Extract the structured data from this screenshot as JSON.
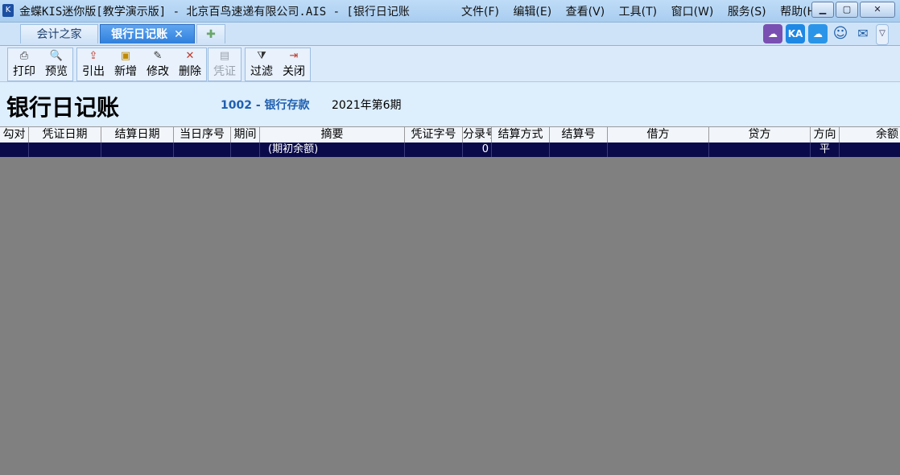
{
  "window": {
    "title": "金蝶KIS迷你版[教学演示版] - 北京百鸟速递有限公司.AIS - [银行日记账",
    "icons": {
      "app": "kingdee-logo-icon",
      "minimize": "minimize-icon",
      "maximize": "maximize-icon",
      "close": "close-icon"
    }
  },
  "menu": [
    "文件(F)",
    "编辑(E)",
    "查看(V)",
    "工具(T)",
    "窗口(W)",
    "服务(S)",
    "帮助(H)"
  ],
  "tabs": [
    {
      "label": "会计之家"
    },
    {
      "label": "银行日记账",
      "close": "✕"
    },
    {
      "label": "✚"
    }
  ],
  "tray_icons": [
    "cloud-app-icon",
    "ka-icon",
    "cloud-service-icon",
    "smiley-icon",
    "message-icon",
    "dropdown-icon"
  ],
  "tray_labels": {
    "ka": "KA",
    "smiley": "☺",
    "message": "✉",
    "dropdown": "▽"
  },
  "toolbar": [
    {
      "label": "打印",
      "icon": "printer-icon",
      "glyph": "⎙",
      "enabled": true
    },
    {
      "label": "预览",
      "icon": "preview-icon",
      "glyph": "🔍",
      "enabled": true
    },
    {
      "label": "引出",
      "icon": "export-icon",
      "glyph": "⇪",
      "enabled": true
    },
    {
      "label": "新增",
      "icon": "add-icon",
      "glyph": "▣",
      "enabled": true
    },
    {
      "label": "修改",
      "icon": "edit-icon",
      "glyph": "✎",
      "enabled": true
    },
    {
      "label": "删除",
      "icon": "delete-icon",
      "glyph": "✕",
      "enabled": true
    },
    {
      "label": "凭证",
      "icon": "voucher-icon",
      "glyph": "▤",
      "enabled": false
    },
    {
      "label": "过滤",
      "icon": "filter-icon",
      "glyph": "⧩",
      "enabled": true
    },
    {
      "label": "关闭",
      "icon": "exit-icon",
      "glyph": "⇥",
      "enabled": true
    }
  ],
  "page": {
    "title": "银行日记账",
    "account": "1002 - 银行存款",
    "period": "2021年第6期"
  },
  "grid": {
    "columns": [
      "勾对",
      "凭证日期",
      "结算日期",
      "当日序号",
      "期间",
      "摘要",
      "凭证字号",
      "分录号",
      "结算方式",
      "结算号",
      "借方",
      "贷方",
      "方向",
      "余额"
    ],
    "rows": [
      [
        "",
        "",
        "",
        "",
        "",
        "(期初余额)",
        "",
        "0",
        "",
        "",
        "",
        "",
        "平",
        ""
      ]
    ]
  },
  "colors": {
    "selected_row": "#0a0a4a",
    "workspace": "#808080",
    "tab_active": "#2f7fdc"
  }
}
